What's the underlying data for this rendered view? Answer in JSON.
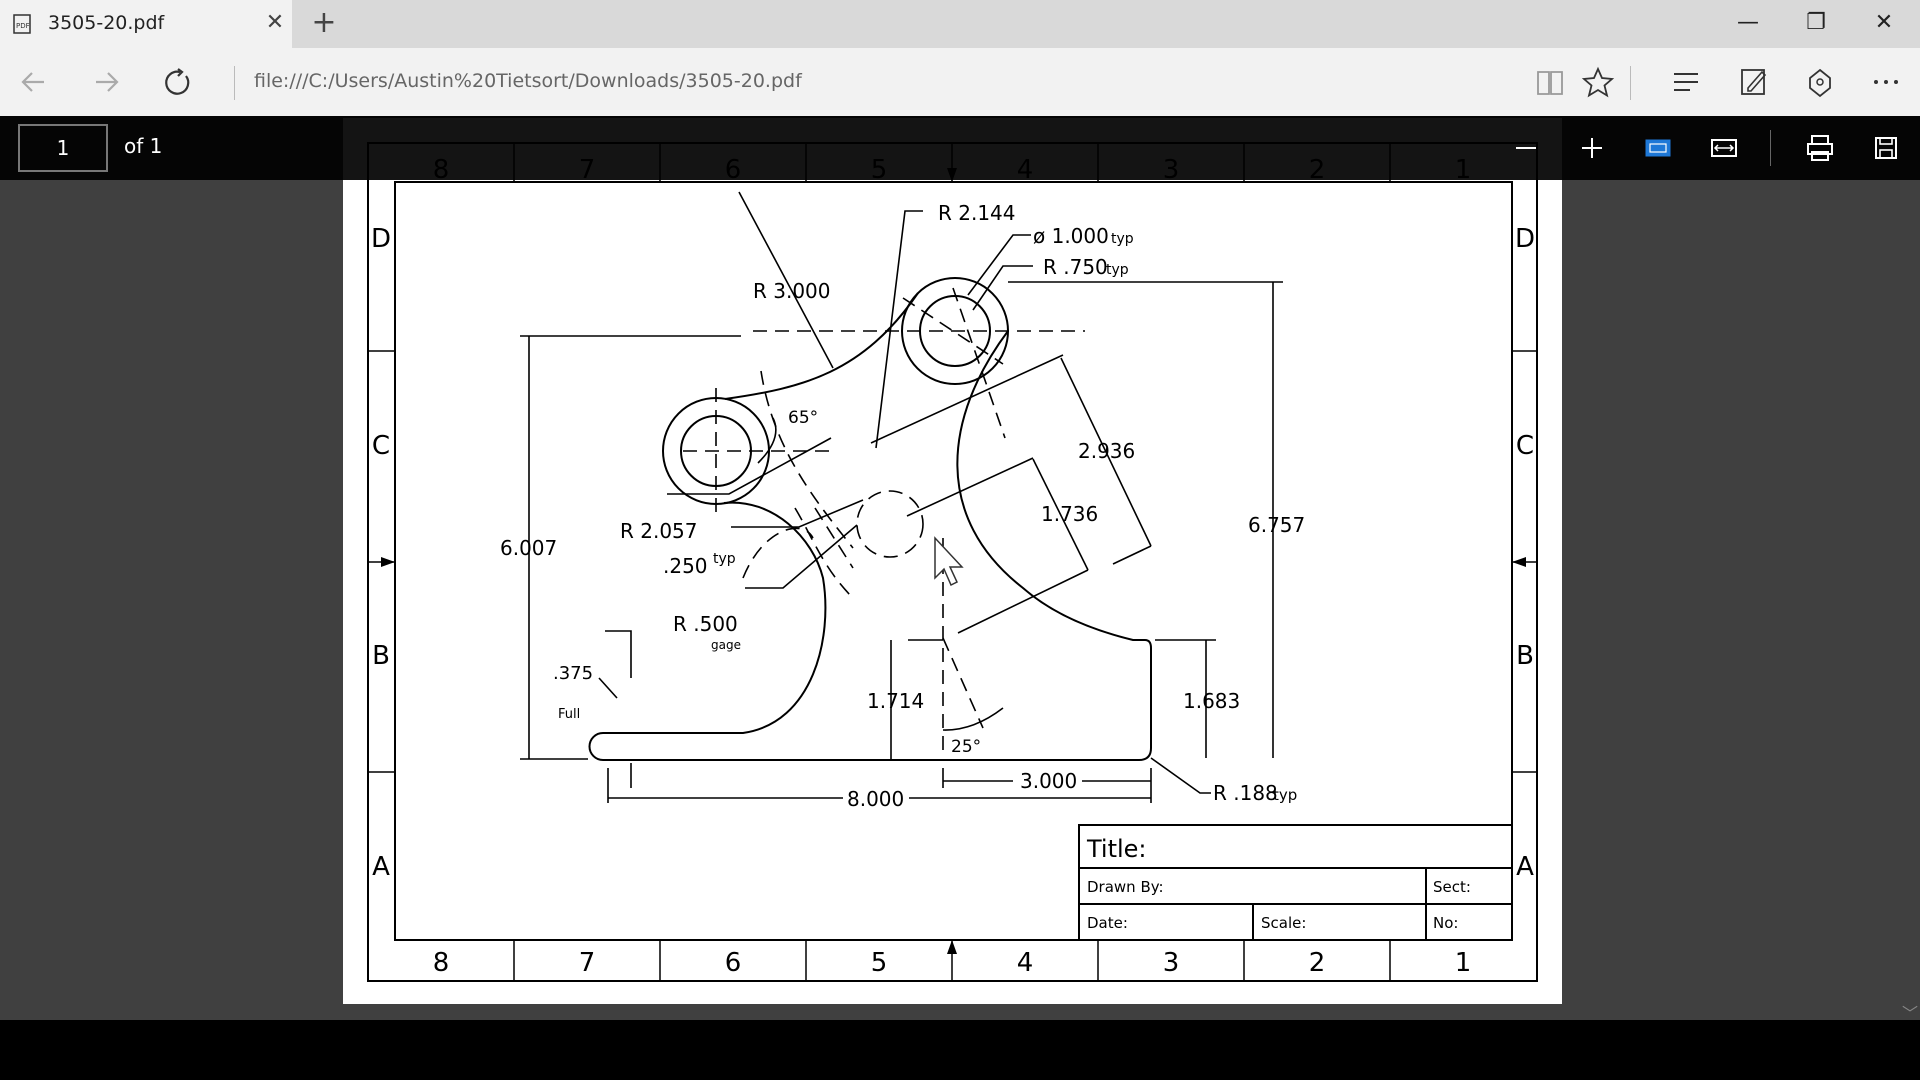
{
  "tab": {
    "title": "3505-20.pdf",
    "close": "✕",
    "new": "+"
  },
  "window": {
    "minimize": "—",
    "restore": "❐",
    "close": "✕"
  },
  "address": {
    "url": "file:///C:/Users/Austin%20Tietsort/Downloads/3505-20.pdf"
  },
  "pdf_toolbar": {
    "page_number": "1",
    "page_total": "of 1"
  },
  "drawing": {
    "grid_cols": [
      "8",
      "7",
      "6",
      "5",
      "4",
      "3",
      "2",
      "1"
    ],
    "grid_rows": [
      "D",
      "C",
      "B",
      "A"
    ],
    "dims": {
      "r2144": "R 2.144",
      "dia1000": "ø 1.000",
      "typ1": "typ",
      "r750": "R .750",
      "typ2": "typ",
      "r3000": "R 3.000",
      "ang65": "65°",
      "d2936": "2.936",
      "d6757": "6.757",
      "d1736": "1.736",
      "d6007": "6.007",
      "r2057": "R 2.057",
      "d250": ".250",
      "typ3": "typ",
      "r500": "R .500",
      "gage": "gage",
      "d375": ".375",
      "full": "Full",
      "d1714": "1.714",
      "ang25": "25°",
      "d1683": "1.683",
      "d3000": "3.000",
      "d8000": "8.000",
      "r188": "R .188",
      "typ4": "typ"
    },
    "titleblock": {
      "title": "Title:",
      "drawn_by": "Drawn By:",
      "sect": "Sect:",
      "date": "Date:",
      "scale": "Scale:",
      "no": "No:"
    }
  }
}
